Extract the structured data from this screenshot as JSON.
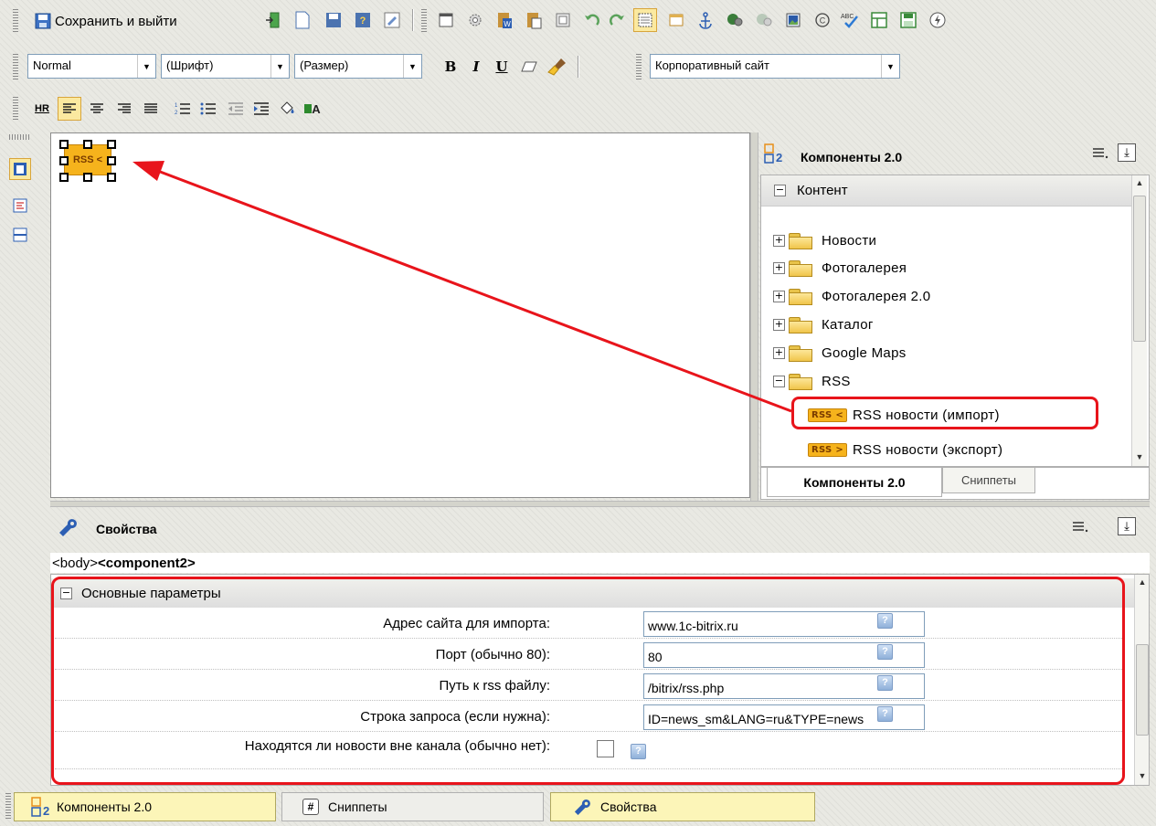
{
  "toolbar1": {
    "save_exit_label": "Сохранить и выйти"
  },
  "toolbar2": {
    "style_value": "Normal",
    "font_value": "(Шрифт)",
    "size_value": "(Размер)",
    "bold_label": "B",
    "italic_label": "I",
    "underline_label": "U",
    "template_value": "Корпоративный сайт"
  },
  "toolbar3": {
    "hr_label": "HR"
  },
  "editor": {
    "component_label": "RSS"
  },
  "components_panel": {
    "title": "Компоненты 2.0",
    "section": "Контент",
    "items": [
      {
        "label": "Новости",
        "toggle": "+"
      },
      {
        "label": "Фотогалерея",
        "toggle": "+"
      },
      {
        "label": "Фотогалерея 2.0",
        "toggle": "+"
      },
      {
        "label": "Каталог",
        "toggle": "+"
      },
      {
        "label": "Google Maps",
        "toggle": "+"
      },
      {
        "label": "RSS",
        "toggle": "−"
      }
    ],
    "rss_children": [
      {
        "tag": "RSS <",
        "label": "RSS новости (импорт)"
      },
      {
        "tag": "RSS >",
        "label": "RSS новости (экспорт)"
      }
    ],
    "tabs": {
      "components": "Компоненты 2.0",
      "snippets": "Сниппеты"
    }
  },
  "properties_panel": {
    "title": "Свойства",
    "path_body": "<body>",
    "path_component": "<component2>",
    "group": "Основные параметры",
    "fields": [
      {
        "label": "Адрес сайта для импорта:",
        "value": "www.1c-bitrix.ru"
      },
      {
        "label": "Порт (обычно 80):",
        "value": "80"
      },
      {
        "label": "Путь к rss файлу:",
        "value": "/bitrix/rss.php"
      },
      {
        "label": "Строка запроса (если нужна):",
        "value": "ID=news_sm&LANG=ru&TYPE=news"
      }
    ],
    "checkbox_label": "Находятся ли новости вне канала (обычно нет):",
    "help_label": "?"
  },
  "bottom_tabs": {
    "components": "Компоненты 2.0",
    "snippets": "Сниппеты",
    "properties": "Свойства"
  },
  "colors": {
    "highlight_red": "#e8141b",
    "accent_yellow": "#fcf5b8",
    "tag_orange": "#f6b31c"
  }
}
